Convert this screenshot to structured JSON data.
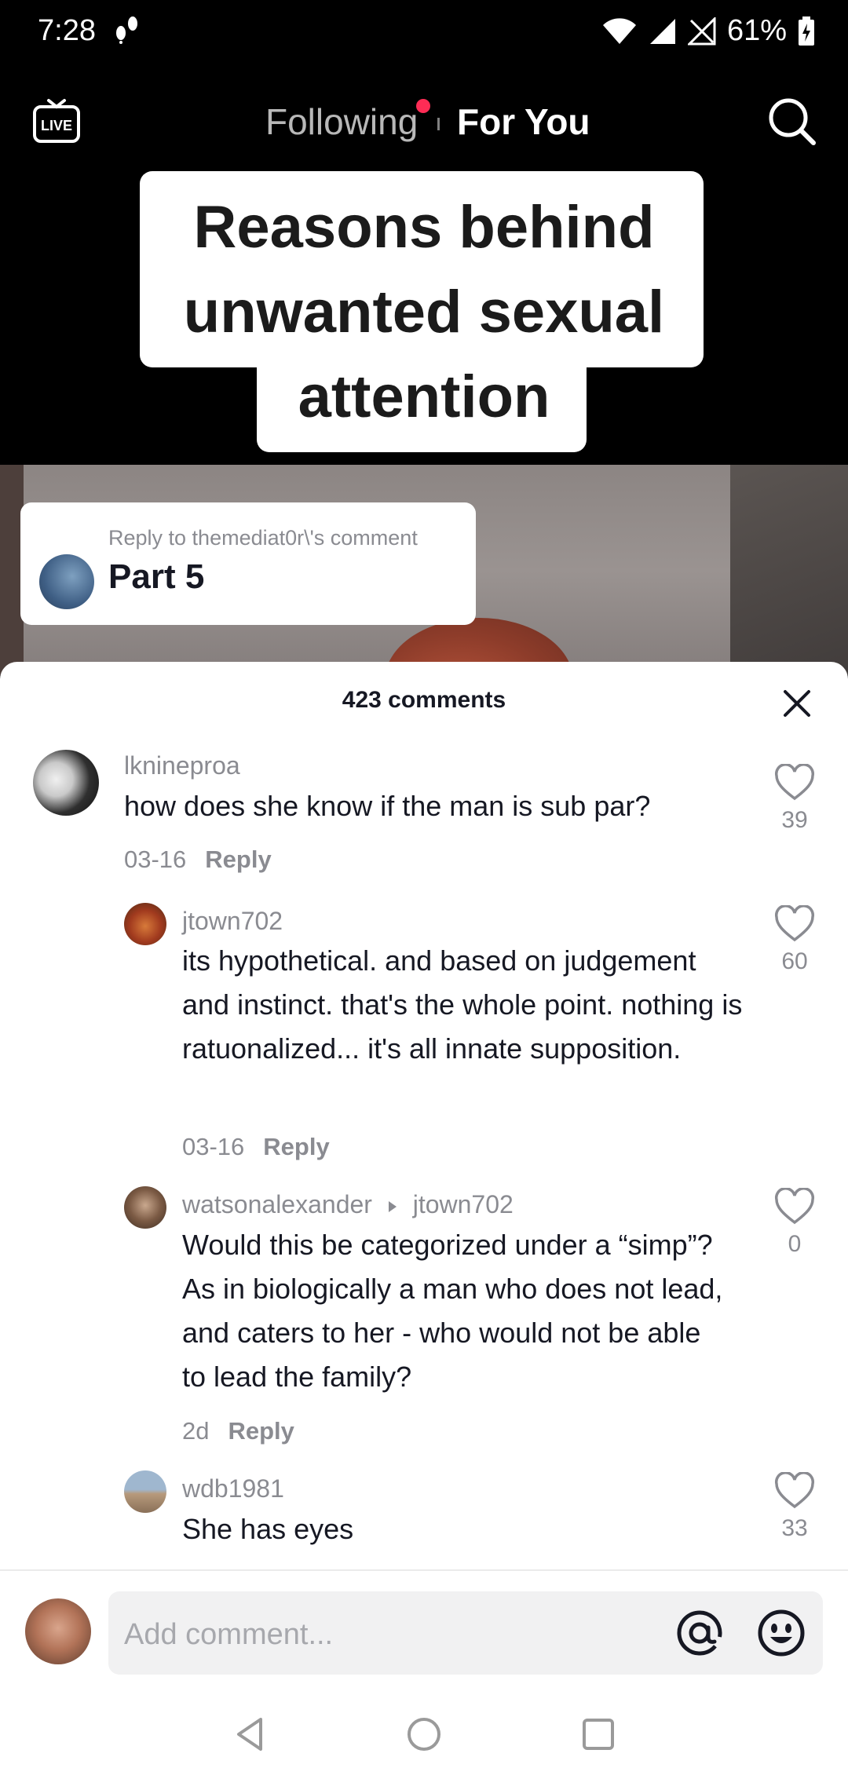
{
  "status_bar": {
    "time": "7:28",
    "battery": "61%"
  },
  "top_nav": {
    "live_label": "LIVE",
    "tab_following": "Following",
    "tab_for_you": "For You"
  },
  "video": {
    "caption_lines": [
      "Reasons behind",
      "unwanted sexual",
      "attention"
    ],
    "reply_card": {
      "label": "Reply to themediat0r\\'s comment",
      "title": "Part 5"
    }
  },
  "comments_panel": {
    "header": "423 comments",
    "comments": [
      {
        "username": "lknineproa",
        "text": "how does she know if the man is sub par?",
        "date": "03-16",
        "reply_label": "Reply",
        "likes": "39"
      },
      {
        "username": "jtown702",
        "text": "its hypothetical. and based on judgement and instinct. that's the whole point. nothing is ratuonalized... it's all innate supposition.",
        "date": "03-16",
        "reply_label": "Reply",
        "likes": "60"
      },
      {
        "username": "watsonalexander",
        "reply_to": "jtown702",
        "text": "Would this be categorized under a “simp”? As in biologically a man who does not lead, and caters to her - who would not be able to lead the family?",
        "date": "2d",
        "reply_label": "Reply",
        "likes": "0"
      },
      {
        "username": "wdb1981",
        "text": "She has eyes",
        "likes": "33"
      }
    ],
    "composer": {
      "placeholder": "Add comment..."
    }
  },
  "colors": {
    "accent": "#fe2c55",
    "muted_text": "#8a8b91",
    "primary_text": "#161823"
  }
}
